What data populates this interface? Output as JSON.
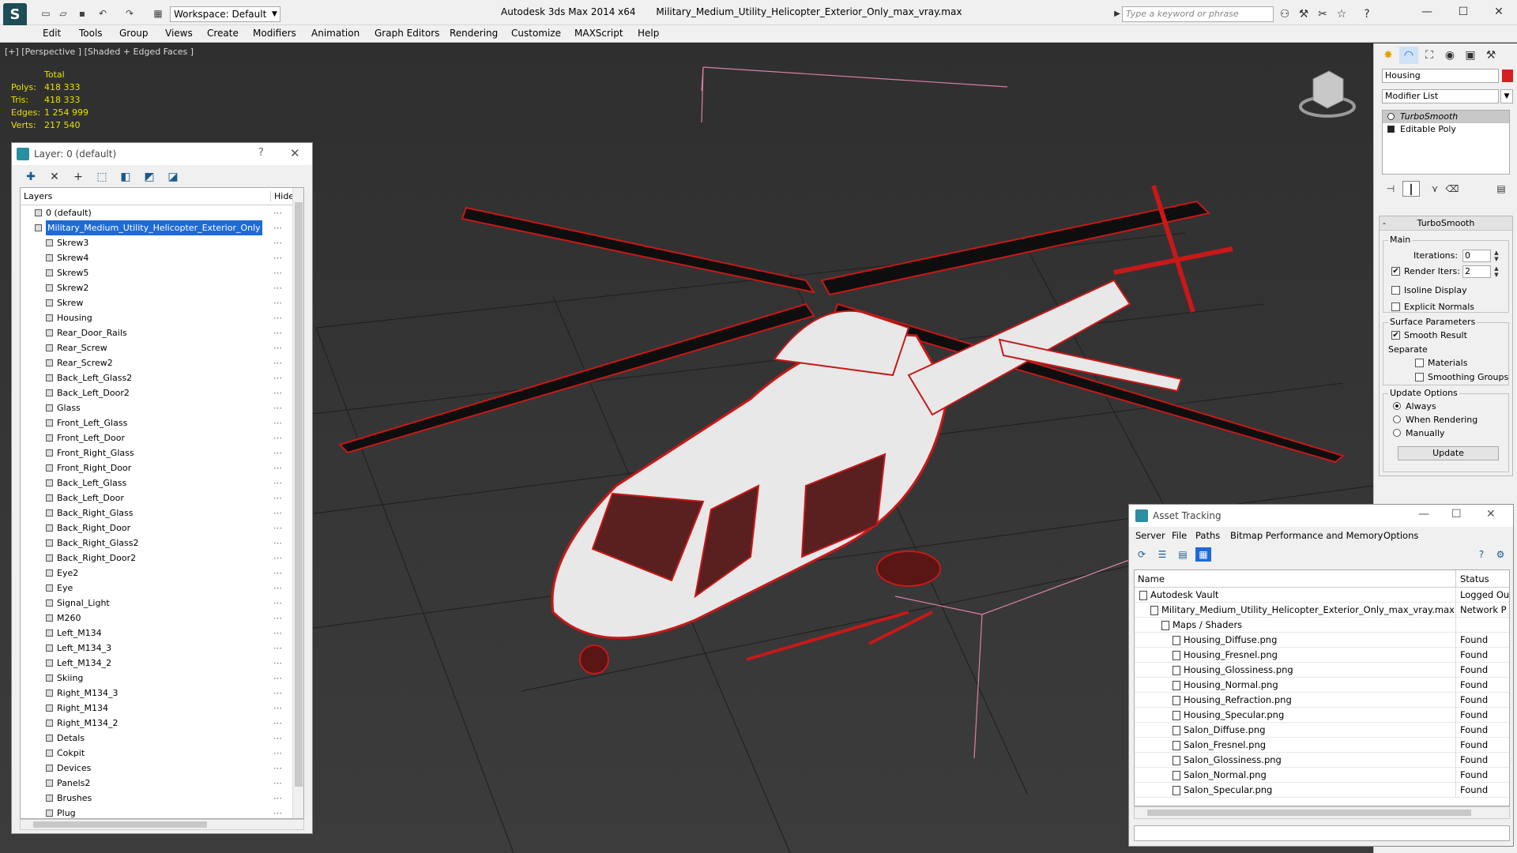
{
  "titlebar": {
    "workspace": "Workspace: Default",
    "app_title": "Autodesk 3ds Max  2014 x64",
    "file_name": "Military_Medium_Utility_Helicopter_Exterior_Only_max_vray.max",
    "search_placeholder": "Type a keyword or phrase"
  },
  "menu": [
    "Edit",
    "Tools",
    "Group",
    "Views",
    "Create",
    "Modifiers",
    "Animation",
    "Graph Editors",
    "Rendering",
    "Customize",
    "MAXScript",
    "Help"
  ],
  "viewport": {
    "label": "[+] [Perspective ] [Shaded + Edged Faces ]",
    "stats": {
      "header": "Total",
      "rows": [
        {
          "k": "Polys:",
          "v": "418 333"
        },
        {
          "k": "Tris:",
          "v": "418 333"
        },
        {
          "k": "Edges:",
          "v": "1 254 999"
        },
        {
          "k": "Verts:",
          "v": "217 540"
        }
      ]
    }
  },
  "layer_dialog": {
    "title": "Layer: 0 (default)",
    "help": "?",
    "close": "✕",
    "col_layers": "Layers",
    "col_hide": "Hide",
    "default_layer": "0 (default)",
    "selected_layer": "Military_Medium_Utility_Helicopter_Exterior_Only",
    "objects": [
      "Skrew3",
      "Skrew4",
      "Skrew5",
      "Skrew2",
      "Skrew",
      "Housing",
      "Rear_Door_Rails",
      "Rear_Screw",
      "Rear_Screw2",
      "Back_Left_Glass2",
      "Back_Left_Door2",
      "Glass",
      "Front_Left_Glass",
      "Front_Left_Door",
      "Front_Right_Glass",
      "Front_Right_Door",
      "Back_Left_Glass",
      "Back_Left_Door",
      "Back_Right_Glass",
      "Back_Right_Door",
      "Back_Right_Glass2",
      "Back_Right_Door2",
      "Eye2",
      "Eye",
      "Signal_Light",
      "M260",
      "Left_M134",
      "Left_M134_3",
      "Left_M134_2",
      "Skiing",
      "Right_M134_3",
      "Right_M134",
      "Right_M134_2",
      "Detals",
      "Cokpit",
      "Devices",
      "Panels2",
      "Brushes",
      "Plug"
    ]
  },
  "command_panel": {
    "object_name": "Housing",
    "object_color": "#d42020",
    "modifier_list": "Modifier List",
    "stack": [
      "TurboSmooth",
      "Editable Poly"
    ],
    "rollout_title": "TurboSmooth",
    "main_group": "Main",
    "iterations_label": "Iterations:",
    "iterations_value": "0",
    "render_iters_label": "Render Iters:",
    "render_iters_value": "2",
    "render_iters_checked": true,
    "isoline_label": "Isoline Display",
    "explicit_normals_label": "Explicit Normals",
    "surface_group": "Surface Parameters",
    "smooth_result_label": "Smooth Result",
    "separate_label": "Separate",
    "materials_label": "Materials",
    "smoothing_groups_label": "Smoothing Groups",
    "update_group": "Update Options",
    "always_label": "Always",
    "when_rendering_label": "When Rendering",
    "manually_label": "Manually",
    "update_button": "Update"
  },
  "asset_tracking": {
    "title": "Asset Tracking",
    "menu": [
      "Server",
      "File",
      "Paths",
      "Bitmap Performance and Memory",
      "Options"
    ],
    "col_name": "Name",
    "col_status": "Status",
    "rows": [
      {
        "name": "Autodesk Vault",
        "status": "Logged Ou",
        "indent": 0
      },
      {
        "name": "Military_Medium_Utility_Helicopter_Exterior_Only_max_vray.max",
        "status": "Network P",
        "indent": 1
      },
      {
        "name": "Maps / Shaders",
        "status": "",
        "indent": 2
      },
      {
        "name": "Housing_Diffuse.png",
        "status": "Found",
        "indent": 3
      },
      {
        "name": "Housing_Fresnel.png",
        "status": "Found",
        "indent": 3
      },
      {
        "name": "Housing_Glossiness.png",
        "status": "Found",
        "indent": 3
      },
      {
        "name": "Housing_Normal.png",
        "status": "Found",
        "indent": 3
      },
      {
        "name": "Housing_Refraction.png",
        "status": "Found",
        "indent": 3
      },
      {
        "name": "Housing_Specular.png",
        "status": "Found",
        "indent": 3
      },
      {
        "name": "Salon_Diffuse.png",
        "status": "Found",
        "indent": 3
      },
      {
        "name": "Salon_Fresnel.png",
        "status": "Found",
        "indent": 3
      },
      {
        "name": "Salon_Glossiness.png",
        "status": "Found",
        "indent": 3
      },
      {
        "name": "Salon_Normal.png",
        "status": "Found",
        "indent": 3
      },
      {
        "name": "Salon_Specular.png",
        "status": "Found",
        "indent": 3
      }
    ]
  },
  "colors": {
    "wire": "#c81818",
    "stats": "#e6e100",
    "selection": "#1e6ad6"
  }
}
